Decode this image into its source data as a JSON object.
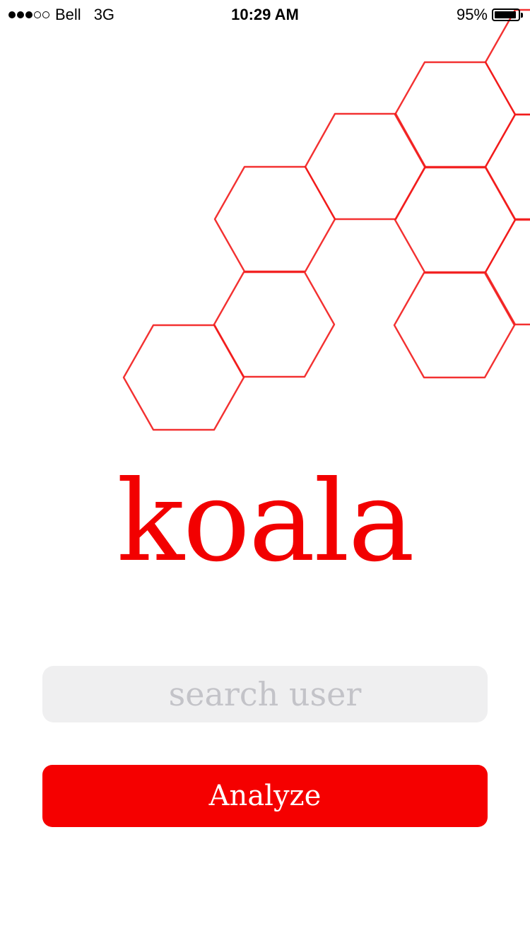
{
  "status_bar": {
    "carrier": "Bell",
    "network": "3G",
    "time": "10:29 AM",
    "battery_percent": "95%",
    "battery_level": 0.95,
    "signal_bars_filled": 3,
    "signal_bars_total": 5
  },
  "logo": {
    "text": "koala",
    "color": "#f20000"
  },
  "search": {
    "placeholder": "search user",
    "value": ""
  },
  "analyze_button": {
    "label": "Analyze",
    "color": "#f50000"
  },
  "decoration": {
    "icon": "hexagon-pattern",
    "stroke_color": "#f21b1b"
  }
}
